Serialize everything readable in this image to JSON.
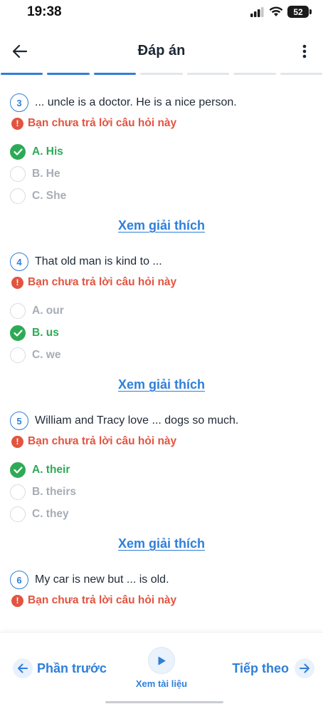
{
  "status_bar": {
    "time": "19:38",
    "battery": "52"
  },
  "header": {
    "title": "Đáp án"
  },
  "progress": {
    "total_segments": 7,
    "active_segments": 3
  },
  "questions": [
    {
      "number": "3",
      "text": "... uncle is a doctor. He is a nice person.",
      "warning": "Bạn chưa trả lời câu hỏi này",
      "options": [
        {
          "label": "A. His",
          "correct": true
        },
        {
          "label": "B. He",
          "correct": false
        },
        {
          "label": "C. She",
          "correct": false
        }
      ],
      "explain_label": "Xem giải thích"
    },
    {
      "number": "4",
      "text": "That old man is kind to ...",
      "warning": "Bạn chưa trả lời câu hỏi này",
      "options": [
        {
          "label": "A. our",
          "correct": false
        },
        {
          "label": "B. us",
          "correct": true
        },
        {
          "label": "C. we",
          "correct": false
        }
      ],
      "explain_label": "Xem giải thích"
    },
    {
      "number": "5",
      "text": "William and Tracy love ... dogs so much.",
      "warning": "Bạn chưa trả lời câu hỏi này",
      "options": [
        {
          "label": "A. their",
          "correct": true
        },
        {
          "label": "B. theirs",
          "correct": false
        },
        {
          "label": "C. they",
          "correct": false
        }
      ],
      "explain_label": "Xem giải thích"
    },
    {
      "number": "6",
      "text": "My car is new but ... is old.",
      "warning": "Bạn chưa trả lời câu hỏi này",
      "options": [],
      "explain_label": ""
    }
  ],
  "bottom_nav": {
    "prev_label": "Phần trước",
    "doc_label": "Xem tài liệu",
    "next_label": "Tiếp theo"
  },
  "colors": {
    "accent": "#2f7fd9",
    "correct": "#2eaa57",
    "warning": "#e25440",
    "muted": "#a7adb5"
  }
}
